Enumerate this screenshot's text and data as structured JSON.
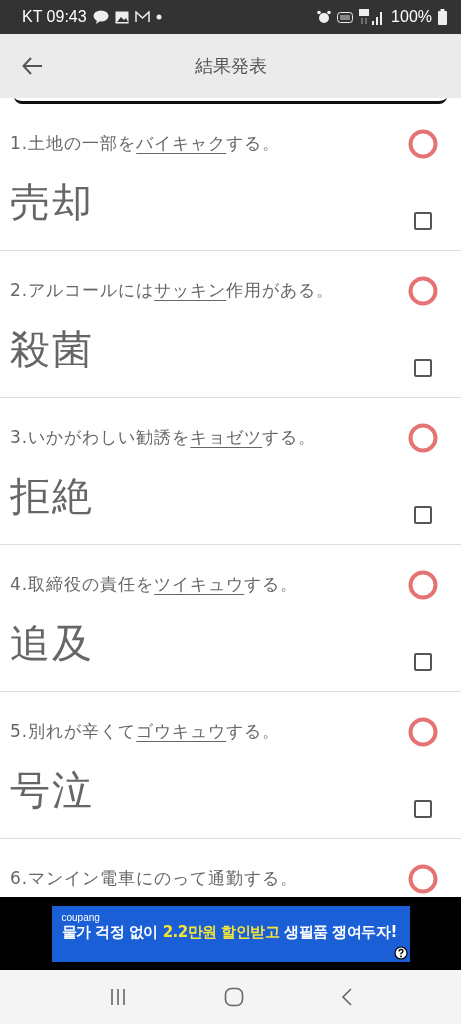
{
  "status_bar": {
    "carrier_time": "KT 09:43",
    "battery": "100%"
  },
  "header": {
    "title": "結果発表"
  },
  "questions": [
    {
      "number": "1.",
      "before": "土地の一部を",
      "underlined": "バイキャク",
      "after": "する。",
      "answer": "売却",
      "correct": true,
      "checked": false
    },
    {
      "number": "2.",
      "before": "アルコールには",
      "underlined": "サッキン",
      "after": "作用がある。",
      "answer": "殺菌",
      "correct": true,
      "checked": false
    },
    {
      "number": "3.",
      "before": "いかがわしい勧誘を",
      "underlined": "キョゼツ",
      "after": "する。",
      "answer": "拒絶",
      "correct": true,
      "checked": false
    },
    {
      "number": "4.",
      "before": "取締役の責任を",
      "underlined": "ツイキュウ",
      "after": "する。",
      "answer": "追及",
      "correct": true,
      "checked": false
    },
    {
      "number": "5.",
      "before": "別れが辛くて",
      "underlined": "ゴウキュウ",
      "after": "する。",
      "answer": "号泣",
      "correct": true,
      "checked": false
    },
    {
      "number": "6.",
      "before": "マンイン電車にのって通勤する。",
      "correct": true
    }
  ],
  "ad": {
    "brand": "coupang",
    "text_1": "물가 걱정 없이",
    "highlight": "2.2만원 할인받고",
    "text_2": "생필품 쟁여두자!"
  }
}
